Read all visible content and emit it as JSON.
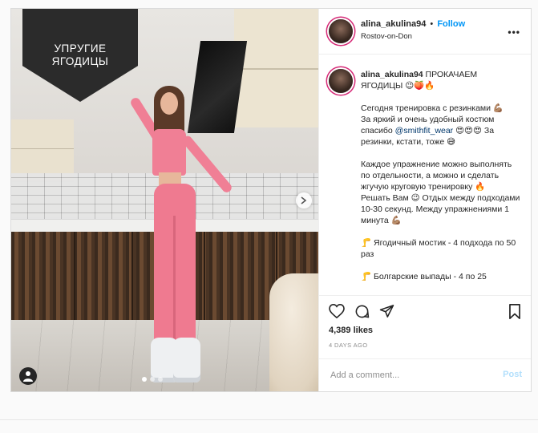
{
  "overlay": {
    "title": "УПРУГИЕ ЯГОДИЦЫ"
  },
  "carousel": {
    "count": 3,
    "active": 1
  },
  "header": {
    "username": "alina_akulina94",
    "separator": "•",
    "follow": "Follow",
    "location": "Rostov-on-Don",
    "more": "•••"
  },
  "caption": {
    "username": "alina_akulina94",
    "lines": [
      " ПРОКАЧАЕМ ЯГОДИЦЫ 😉🍑🔥",
      "",
      "Сегодня тренировка с резинками 💪🏽",
      "За яркий и очень удобный костюм спасибо ",
      "@smithfit_wear",
      " 😍😍😍 За резинки, кстати, тоже 😅",
      "",
      "Каждое упражнение можно выполнять по отдельности, а можно и сделать жгучую круговую тренировку 🔥",
      "Решать Вам 😉 Отдых между подходами 10-30 секунд. Между упражнениями 1 минута 💪🏽",
      "",
      "🦵 Ягодичный мостик - 4 подхода по 50 раз",
      "",
      "🦵 Болгарские выпады - 4 по 25"
    ]
  },
  "actions": {
    "likes": "4,389 likes",
    "time": "4 DAYS AGO",
    "comment_placeholder": "Add a comment...",
    "post": "Post"
  }
}
